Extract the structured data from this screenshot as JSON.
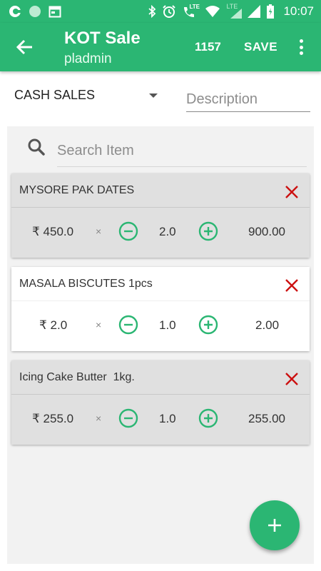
{
  "status_bar": {
    "time": "10:07",
    "network_label": "LTE",
    "call_label": "LTE",
    "left_icons": [
      "notification-icon",
      "circle-icon",
      "calendar-icon"
    ],
    "right_icons": [
      "bluetooth-icon",
      "alarm-icon",
      "volte-call-icon",
      "wifi-icon",
      "signal-icon",
      "signal-icon",
      "battery-icon"
    ]
  },
  "toolbar": {
    "title": "KOT Sale",
    "subtitle": "pladmin",
    "count": "1157",
    "save_label": "SAVE",
    "back_icon": "arrow-back-icon",
    "menu_icon": "more-vert-icon",
    "color": "#2bb673"
  },
  "form": {
    "sale_type": "CASH SALES",
    "description_placeholder": "Description",
    "description_value": ""
  },
  "search": {
    "placeholder": "Search Item"
  },
  "items": [
    {
      "name": "MYSORE PAK DATES",
      "price": "₹ 450.0",
      "times": "×",
      "qty": "2.0",
      "total": "900.00"
    },
    {
      "name": "MASALA BISCUTES 1pcs",
      "price": "₹ 2.0",
      "times": "×",
      "qty": "1.0",
      "total": "2.00"
    },
    {
      "name": "Icing Cake Butter  1kg.",
      "price": "₹ 255.0",
      "times": "×",
      "qty": "1.0",
      "total": "255.00"
    }
  ],
  "fab": {
    "icon": "add-icon"
  },
  "colors": {
    "accent": "#2bb673",
    "remove": "#cc1111"
  }
}
